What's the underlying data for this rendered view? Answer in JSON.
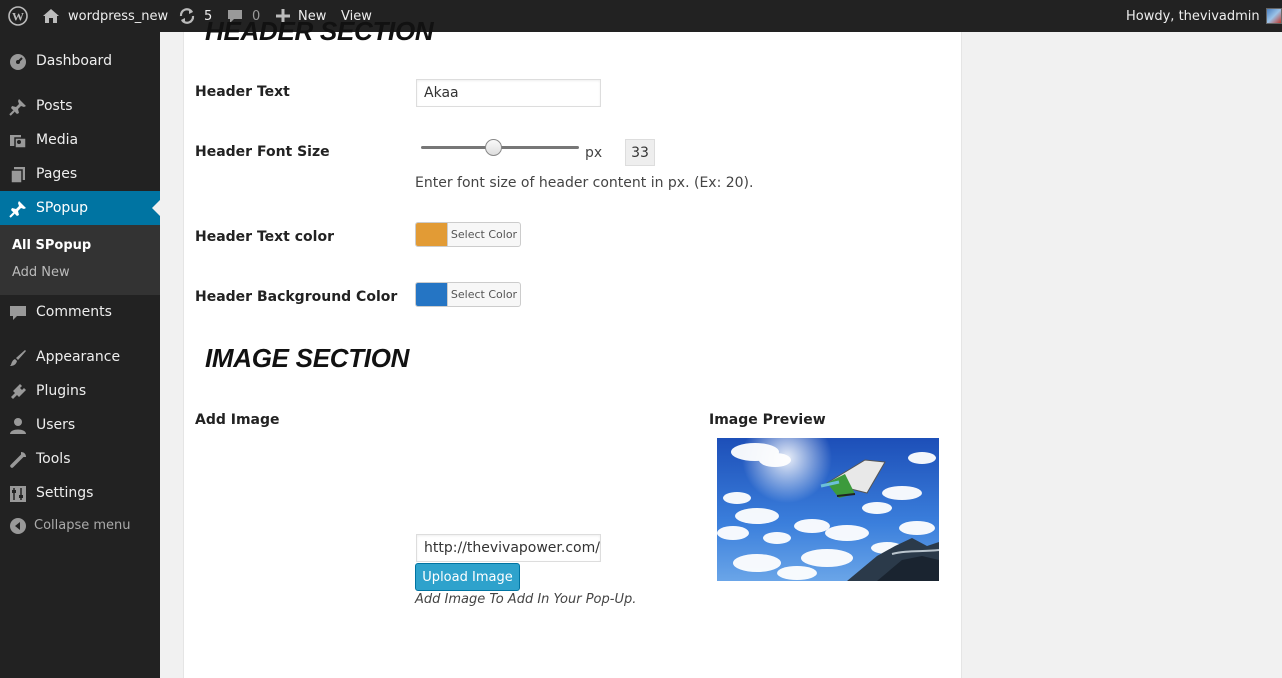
{
  "adminbar": {
    "site_name": "wordpress_new",
    "updates_count": "5",
    "comments_count": "0",
    "new_label": "New",
    "view_label": "View",
    "greeting": "Howdy, thevivadmin"
  },
  "sidebar": {
    "items": [
      {
        "label": "Dashboard",
        "icon": "dashboard-icon"
      },
      {
        "label": "Posts",
        "icon": "pin-icon"
      },
      {
        "label": "Media",
        "icon": "media-icon"
      },
      {
        "label": "Pages",
        "icon": "pages-icon"
      },
      {
        "label": "SPopup",
        "icon": "pin-icon"
      },
      {
        "label": "Comments",
        "icon": "comment-icon"
      },
      {
        "label": "Appearance",
        "icon": "brush-icon"
      },
      {
        "label": "Plugins",
        "icon": "plugin-icon"
      },
      {
        "label": "Users",
        "icon": "user-icon"
      },
      {
        "label": "Tools",
        "icon": "wrench-icon"
      },
      {
        "label": "Settings",
        "icon": "settings-icon"
      }
    ],
    "submenu": [
      "All SPopup",
      "Add New"
    ],
    "collapse_label": "Collapse menu"
  },
  "header_section": {
    "title": "HEADER SECTION",
    "header_text_label": "Header Text",
    "header_text_value": "Akaa",
    "font_size_label": "Header Font Size",
    "font_size_unit": "px",
    "font_size_value": "33",
    "font_size_slider_fraction": 0.45,
    "font_size_desc": "Enter font size of header content in px. (Ex: 20).",
    "text_color_label": "Header Text color",
    "text_color": "#e29b35",
    "bg_color_label": "Header Background Color",
    "bg_color": "#2575c4",
    "select_color_label": "Select Color"
  },
  "image_section": {
    "title": "IMAGE SECTION",
    "add_image_label": "Add Image",
    "preview_label": "Image Preview",
    "url_value": "http://thevivapower.com/wp",
    "upload_label": "Upload Image",
    "hint": "Add Image To Add In Your Pop-Up."
  },
  "colors": {
    "admin_bg": "#222222",
    "accent": "#0074a2",
    "button": "#2ea2cc"
  }
}
